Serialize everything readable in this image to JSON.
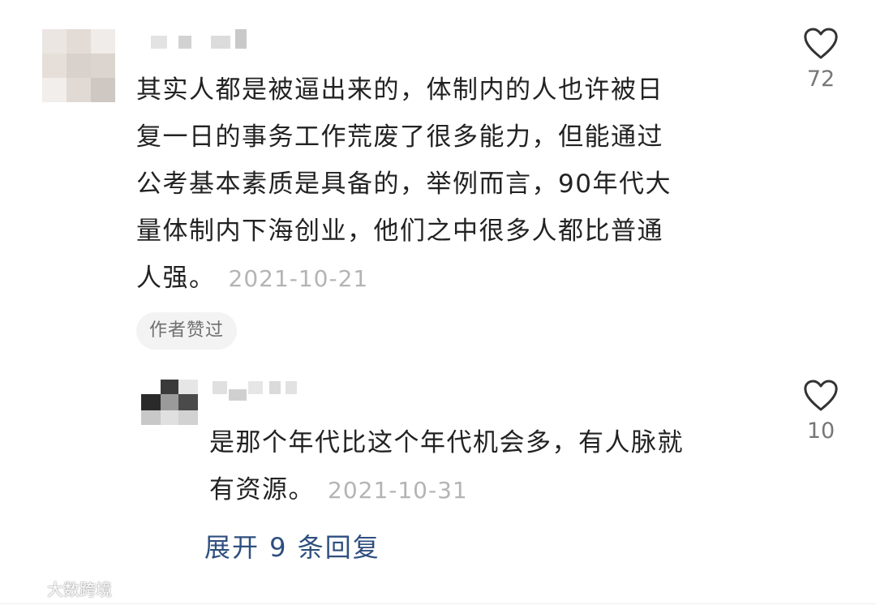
{
  "comments": [
    {
      "text": "其实人都是被逼出来的，体制内的人也许被日复一日的事务工作荒废了很多能力，但能通过公考基本素质是具备的，举例而言，90年代大量体制内下海创业，他们之中很多人都比普通人强。",
      "lines": [
        "其实人都是被逼出来的，体制内的人也许被日",
        "复一日的事务工作荒废了很多能力，但能通过",
        "公考基本素质是具备的，举例而言，90年代大",
        "量体制内下海创业，他们之中很多人都比普通",
        "人强。"
      ],
      "date": "2021-10-21",
      "likes": "72",
      "author_badge": "作者赞过"
    }
  ],
  "replies": [
    {
      "lines": [
        "是那个年代比这个年代机会多，有人脉就",
        "有资源。"
      ],
      "date": "2021-10-31",
      "likes": "10"
    }
  ],
  "expand_replies_label": "展开 9 条回复",
  "watermark": {
    "text": "大数跨境",
    "icon": "brand-logo-icon"
  },
  "icons": {
    "like": "heart-outline-icon"
  },
  "colors": {
    "text": "#222222",
    "muted": "#b4b4b4",
    "link": "#2f4f7f",
    "badge_bg": "#f3f3f3"
  }
}
